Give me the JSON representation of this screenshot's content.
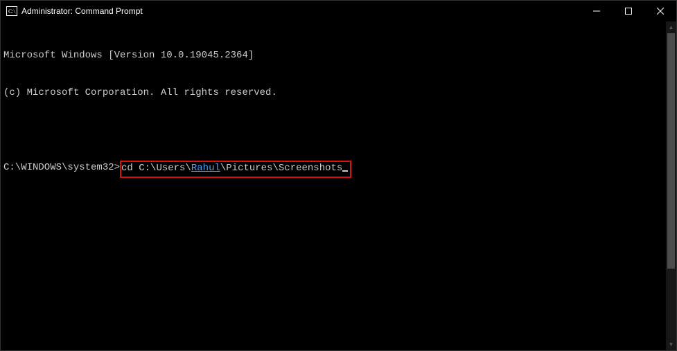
{
  "titlebar": {
    "title": "Administrator: Command Prompt"
  },
  "terminal": {
    "line1": "Microsoft Windows [Version 10.0.19045.2364]",
    "line2": "(c) Microsoft Corporation. All rights reserved.",
    "prompt": "C:\\WINDOWS\\system32>",
    "command_pre": "cd C:\\Users\\",
    "command_user": "Rahul",
    "command_post": "\\Pictures\\Screenshots"
  }
}
